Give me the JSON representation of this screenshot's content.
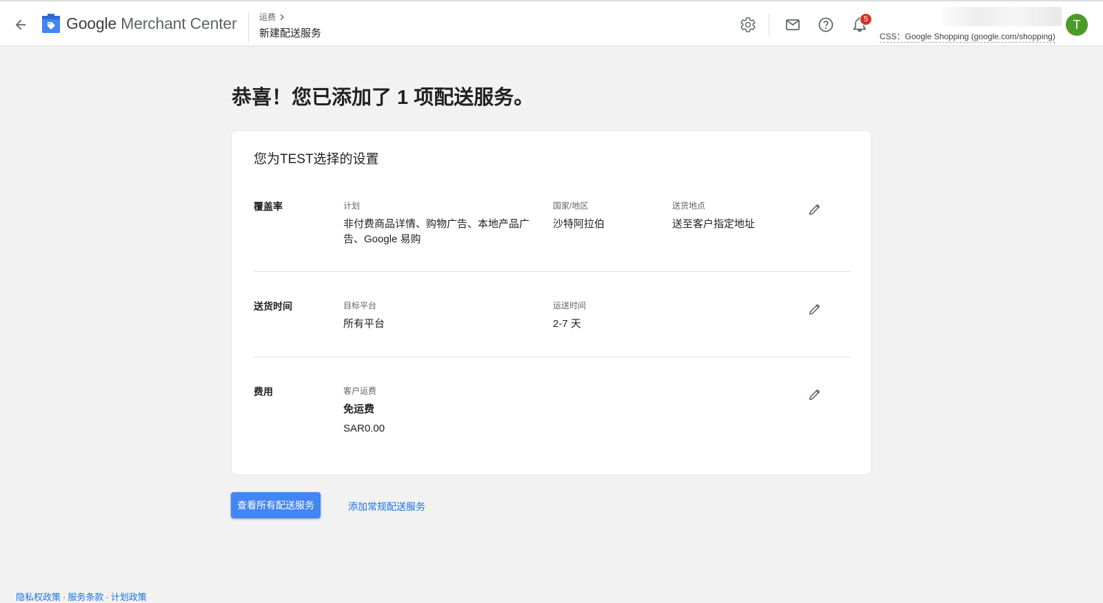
{
  "header": {
    "brand_google": "Google",
    "brand_product": "Merchant Center",
    "breadcrumb_parent": "运费",
    "breadcrumb_current": "新建配送服务",
    "notification_count": "5",
    "css_label": "CSS：Google Shopping (google.com/shopping)",
    "avatar_initial": "T",
    "icons": [
      "back-arrow-icon",
      "merchant-center-logo-icon",
      "gear-icon",
      "mail-icon",
      "help-icon",
      "bell-icon"
    ]
  },
  "main": {
    "title": "恭喜！您已添加了 1 项配送服务。",
    "card_title": "您为TEST选择的设置",
    "coverage": {
      "label": "覆盖率",
      "program_header": "计划",
      "program_value": "非付费商品详情、购物广告、本地产品广告、Google 易购",
      "country_header": "国家/地区",
      "country_value": "沙特阿拉伯",
      "destination_header": "送货地点",
      "destination_value": "送至客户指定地址"
    },
    "delivery_time": {
      "label": "送货时间",
      "platform_header": "目标平台",
      "platform_value": "所有平台",
      "transit_header": "运送时间",
      "transit_value": "2-7 天"
    },
    "cost": {
      "label": "费用",
      "customer_header": "客户运费",
      "customer_value": "免运费",
      "amount": "SAR0.00"
    },
    "primary_button": "查看所有配送服务",
    "secondary_link": "添加常规配送服务"
  },
  "footer": {
    "privacy": "隐私权政策",
    "terms": "服务条款",
    "program_policy": "计划政策",
    "separator": "·"
  },
  "colors": {
    "primary": "#4285f4",
    "link": "#1a73e8",
    "badge": "#d93025",
    "avatar": "#4c9a2a",
    "background": "#f2f2f2"
  }
}
